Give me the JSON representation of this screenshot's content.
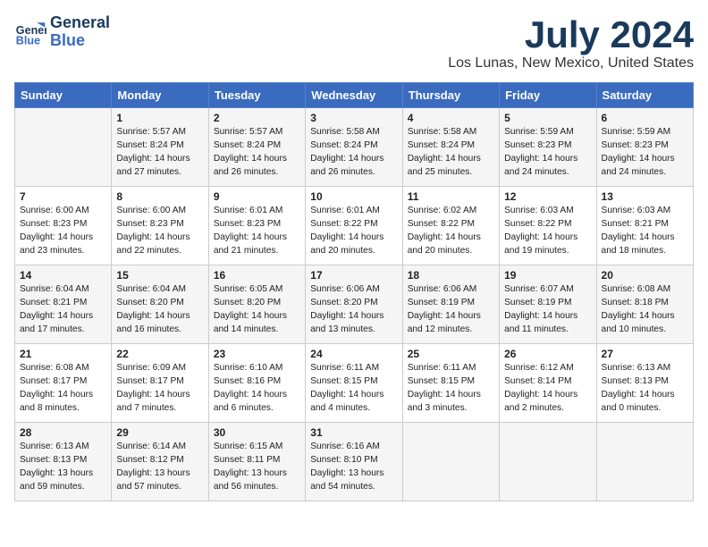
{
  "header": {
    "logo_line1": "General",
    "logo_line2": "Blue",
    "month": "July 2024",
    "location": "Los Lunas, New Mexico, United States"
  },
  "weekdays": [
    "Sunday",
    "Monday",
    "Tuesday",
    "Wednesday",
    "Thursday",
    "Friday",
    "Saturday"
  ],
  "weeks": [
    [
      {
        "day": "",
        "content": ""
      },
      {
        "day": "1",
        "content": "Sunrise: 5:57 AM\nSunset: 8:24 PM\nDaylight: 14 hours\nand 27 minutes."
      },
      {
        "day": "2",
        "content": "Sunrise: 5:57 AM\nSunset: 8:24 PM\nDaylight: 14 hours\nand 26 minutes."
      },
      {
        "day": "3",
        "content": "Sunrise: 5:58 AM\nSunset: 8:24 PM\nDaylight: 14 hours\nand 26 minutes."
      },
      {
        "day": "4",
        "content": "Sunrise: 5:58 AM\nSunset: 8:24 PM\nDaylight: 14 hours\nand 25 minutes."
      },
      {
        "day": "5",
        "content": "Sunrise: 5:59 AM\nSunset: 8:23 PM\nDaylight: 14 hours\nand 24 minutes."
      },
      {
        "day": "6",
        "content": "Sunrise: 5:59 AM\nSunset: 8:23 PM\nDaylight: 14 hours\nand 24 minutes."
      }
    ],
    [
      {
        "day": "7",
        "content": "Sunrise: 6:00 AM\nSunset: 8:23 PM\nDaylight: 14 hours\nand 23 minutes."
      },
      {
        "day": "8",
        "content": "Sunrise: 6:00 AM\nSunset: 8:23 PM\nDaylight: 14 hours\nand 22 minutes."
      },
      {
        "day": "9",
        "content": "Sunrise: 6:01 AM\nSunset: 8:23 PM\nDaylight: 14 hours\nand 21 minutes."
      },
      {
        "day": "10",
        "content": "Sunrise: 6:01 AM\nSunset: 8:22 PM\nDaylight: 14 hours\nand 20 minutes."
      },
      {
        "day": "11",
        "content": "Sunrise: 6:02 AM\nSunset: 8:22 PM\nDaylight: 14 hours\nand 20 minutes."
      },
      {
        "day": "12",
        "content": "Sunrise: 6:03 AM\nSunset: 8:22 PM\nDaylight: 14 hours\nand 19 minutes."
      },
      {
        "day": "13",
        "content": "Sunrise: 6:03 AM\nSunset: 8:21 PM\nDaylight: 14 hours\nand 18 minutes."
      }
    ],
    [
      {
        "day": "14",
        "content": "Sunrise: 6:04 AM\nSunset: 8:21 PM\nDaylight: 14 hours\nand 17 minutes."
      },
      {
        "day": "15",
        "content": "Sunrise: 6:04 AM\nSunset: 8:20 PM\nDaylight: 14 hours\nand 16 minutes."
      },
      {
        "day": "16",
        "content": "Sunrise: 6:05 AM\nSunset: 8:20 PM\nDaylight: 14 hours\nand 14 minutes."
      },
      {
        "day": "17",
        "content": "Sunrise: 6:06 AM\nSunset: 8:20 PM\nDaylight: 14 hours\nand 13 minutes."
      },
      {
        "day": "18",
        "content": "Sunrise: 6:06 AM\nSunset: 8:19 PM\nDaylight: 14 hours\nand 12 minutes."
      },
      {
        "day": "19",
        "content": "Sunrise: 6:07 AM\nSunset: 8:19 PM\nDaylight: 14 hours\nand 11 minutes."
      },
      {
        "day": "20",
        "content": "Sunrise: 6:08 AM\nSunset: 8:18 PM\nDaylight: 14 hours\nand 10 minutes."
      }
    ],
    [
      {
        "day": "21",
        "content": "Sunrise: 6:08 AM\nSunset: 8:17 PM\nDaylight: 14 hours\nand 8 minutes."
      },
      {
        "day": "22",
        "content": "Sunrise: 6:09 AM\nSunset: 8:17 PM\nDaylight: 14 hours\nand 7 minutes."
      },
      {
        "day": "23",
        "content": "Sunrise: 6:10 AM\nSunset: 8:16 PM\nDaylight: 14 hours\nand 6 minutes."
      },
      {
        "day": "24",
        "content": "Sunrise: 6:11 AM\nSunset: 8:15 PM\nDaylight: 14 hours\nand 4 minutes."
      },
      {
        "day": "25",
        "content": "Sunrise: 6:11 AM\nSunset: 8:15 PM\nDaylight: 14 hours\nand 3 minutes."
      },
      {
        "day": "26",
        "content": "Sunrise: 6:12 AM\nSunset: 8:14 PM\nDaylight: 14 hours\nand 2 minutes."
      },
      {
        "day": "27",
        "content": "Sunrise: 6:13 AM\nSunset: 8:13 PM\nDaylight: 14 hours\nand 0 minutes."
      }
    ],
    [
      {
        "day": "28",
        "content": "Sunrise: 6:13 AM\nSunset: 8:13 PM\nDaylight: 13 hours\nand 59 minutes."
      },
      {
        "day": "29",
        "content": "Sunrise: 6:14 AM\nSunset: 8:12 PM\nDaylight: 13 hours\nand 57 minutes."
      },
      {
        "day": "30",
        "content": "Sunrise: 6:15 AM\nSunset: 8:11 PM\nDaylight: 13 hours\nand 56 minutes."
      },
      {
        "day": "31",
        "content": "Sunrise: 6:16 AM\nSunset: 8:10 PM\nDaylight: 13 hours\nand 54 minutes."
      },
      {
        "day": "",
        "content": ""
      },
      {
        "day": "",
        "content": ""
      },
      {
        "day": "",
        "content": ""
      }
    ]
  ]
}
